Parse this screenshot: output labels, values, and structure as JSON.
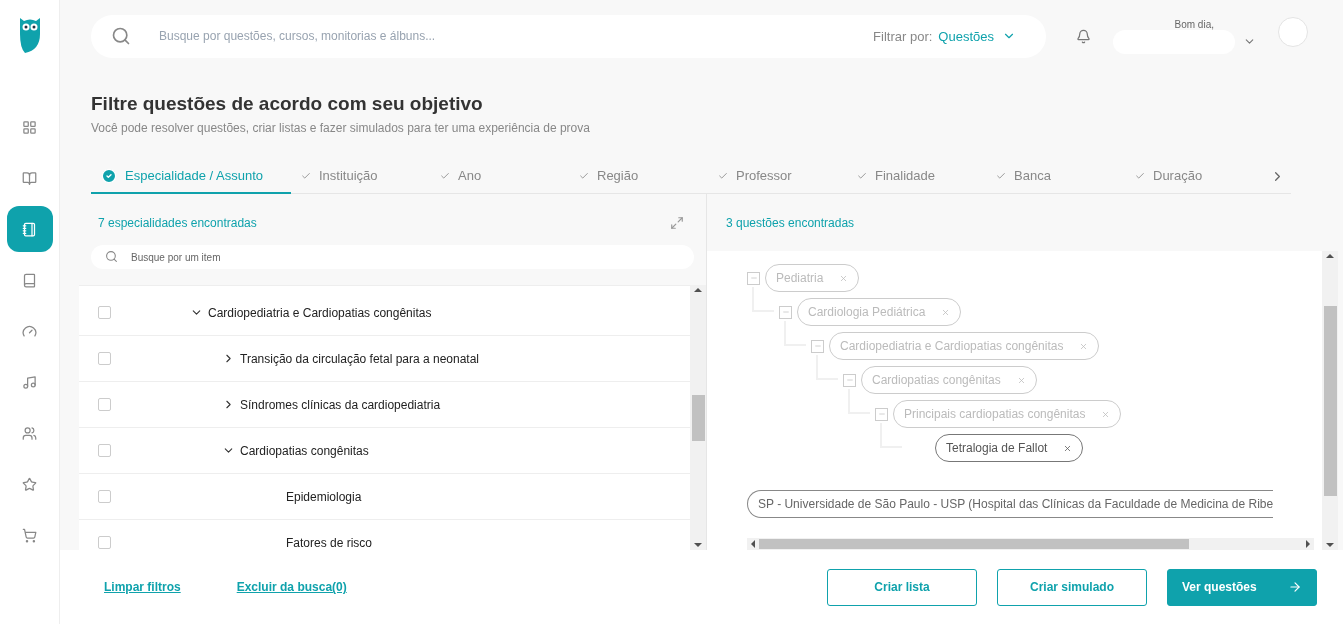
{
  "sidebar": {
    "items": [
      {
        "selected": false
      },
      {
        "selected": false
      },
      {
        "selected": true
      },
      {
        "selected": false
      },
      {
        "selected": false
      },
      {
        "selected": false
      },
      {
        "selected": false
      },
      {
        "selected": false
      },
      {
        "selected": false
      }
    ]
  },
  "topbar": {
    "search": {
      "placeholder": "Busque por questões, cursos, monitorias e álbuns..."
    },
    "filter_label": "Filtrar por:",
    "filter_value": "Questões",
    "greeting": "Bom dia,"
  },
  "page": {
    "title": "Filtre questões de acordo com seu objetivo",
    "subtitle": "Você pode resolver questões, criar listas e fazer simulados para ter uma experiência de prova"
  },
  "tabs": [
    {
      "label": "Especialidade / Assunto",
      "selected": true
    },
    {
      "label": "Instituição",
      "selected": false
    },
    {
      "label": "Ano",
      "selected": false
    },
    {
      "label": "Região",
      "selected": false
    },
    {
      "label": "Professor",
      "selected": false
    },
    {
      "label": "Finalidade",
      "selected": false
    },
    {
      "label": "Banca",
      "selected": false
    },
    {
      "label": "Duração",
      "selected": false
    }
  ],
  "left_panel": {
    "count": "7 especialidades encontradas",
    "search": {
      "placeholder": "Busque por um item"
    },
    "tree": [
      {
        "label": "Cardiopediatria e Cardiopatias congênitas",
        "checked": false,
        "expanded": true,
        "children": [
          {
            "label": "Transição da circulação fetal para a neonatal",
            "checked": false,
            "expanded": false
          },
          {
            "label": "Síndromes clínicas da cardiopediatria",
            "checked": false,
            "expanded": false
          },
          {
            "label": "Cardiopatias congênitas",
            "checked": false,
            "expanded": true,
            "children": [
              {
                "label": "Epidemiologia",
                "checked": false
              },
              {
                "label": "Fatores de risco",
                "checked": false
              }
            ]
          }
        ]
      }
    ]
  },
  "right_panel": {
    "count": "3 questões encontradas",
    "chips": [
      {
        "label": "Pediatria",
        "selected": false,
        "children": [
          {
            "label": "Cardiologia Pediátrica",
            "selected": false,
            "children": [
              {
                "label": "Cardiopediatria e Cardiopatias congênitas",
                "selected": false,
                "children": [
                  {
                    "label": "Cardiopatias congênitas",
                    "selected": false,
                    "children": [
                      {
                        "label": "Principais cardiopatias congênitas",
                        "selected": false,
                        "children": [
                          {
                            "label": "Tetralogia de Fallot",
                            "selected": true
                          }
                        ]
                      }
                    ]
                  }
                ]
              }
            ]
          }
        ]
      }
    ],
    "institution": "SP - Universidade de São Paulo - USP (Hospital das Clínicas da Faculdade de Medicina de Ribe"
  },
  "footer": {
    "links": [
      "Limpar filtros",
      "Excluir da busca(0)"
    ],
    "buttons": [
      {
        "label": "Criar lista",
        "kind": "outline"
      },
      {
        "label": "Criar simulado",
        "kind": "outline"
      },
      {
        "label": "Ver questões",
        "kind": "primary"
      }
    ]
  }
}
